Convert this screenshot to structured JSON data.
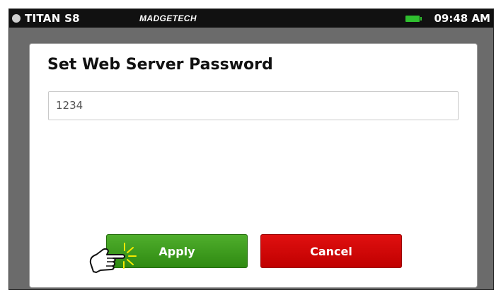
{
  "status_bar": {
    "device_name": "TITAN S8",
    "brand": "MADGETECH",
    "time": "09:48 AM",
    "battery_color": "#2fbf2f"
  },
  "dialog": {
    "title": "Set Web Server Password",
    "password_value": "1234",
    "apply_label": "Apply",
    "cancel_label": "Cancel"
  },
  "colors": {
    "apply_green": "#3a9a1c",
    "cancel_red": "#d40808",
    "statusbar_bg": "#111111",
    "frame_gray": "#6b6b6b"
  },
  "icons": [
    "status-dot-icon",
    "battery-icon",
    "pointing-hand-icon"
  ]
}
